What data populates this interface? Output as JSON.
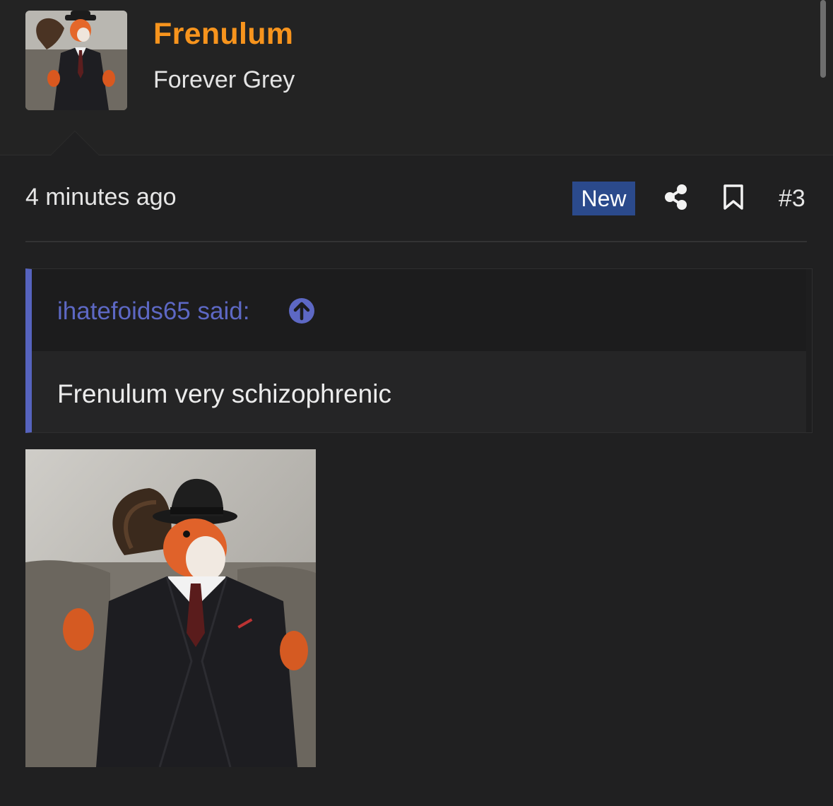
{
  "user": {
    "name": "Frenulum",
    "title": "Forever Grey",
    "avatar_icon": "squirrel-in-suit-avatar"
  },
  "meta": {
    "time": "4 minutes ago",
    "badge": "New",
    "share_icon": "share-icon",
    "bookmark_icon": "bookmark-icon",
    "post_number": "#3"
  },
  "quote": {
    "author": "ihatefoids65 said:",
    "jump_icon": "arrow-up-circle-icon",
    "text": "Frenulum very schizophrenic"
  },
  "image": {
    "icon": "squirrel-in-suit-photo"
  },
  "colors": {
    "background": "#202021",
    "username": "#f7941d",
    "quote_accent": "#5663be",
    "badge": "#2b4a8c"
  }
}
